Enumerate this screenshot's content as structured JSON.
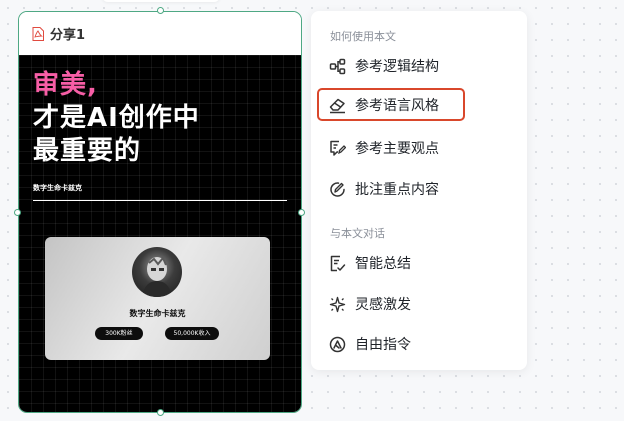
{
  "document": {
    "title": "分享1",
    "headline_line1": "审美,",
    "headline_line2": "才是AI创作中",
    "headline_line3": "最重要的",
    "author": "数字生命卡兹克",
    "profile": {
      "name": "数字生命卡兹克",
      "stat1": "300K粉丝",
      "stat2": "50,000K收入"
    }
  },
  "menu": {
    "section1_label": "如何使用本文",
    "section2_label": "与本文对话",
    "items": [
      {
        "label": "参考逻辑结构",
        "icon": "structure-icon"
      },
      {
        "label": "参考语言风格",
        "icon": "eraser-icon"
      },
      {
        "label": "参考主要观点",
        "icon": "comment-edit-icon"
      },
      {
        "label": "批注重点内容",
        "icon": "pen-circle-icon"
      },
      {
        "label": "智能总结",
        "icon": "summary-icon"
      },
      {
        "label": "灵感激发",
        "icon": "sparkle-icon"
      },
      {
        "label": "自由指令",
        "icon": "command-icon"
      }
    ]
  },
  "colors": {
    "selection_border": "#4ea884",
    "highlight": "#d9472b",
    "headline_accent": "#f75ea6"
  }
}
